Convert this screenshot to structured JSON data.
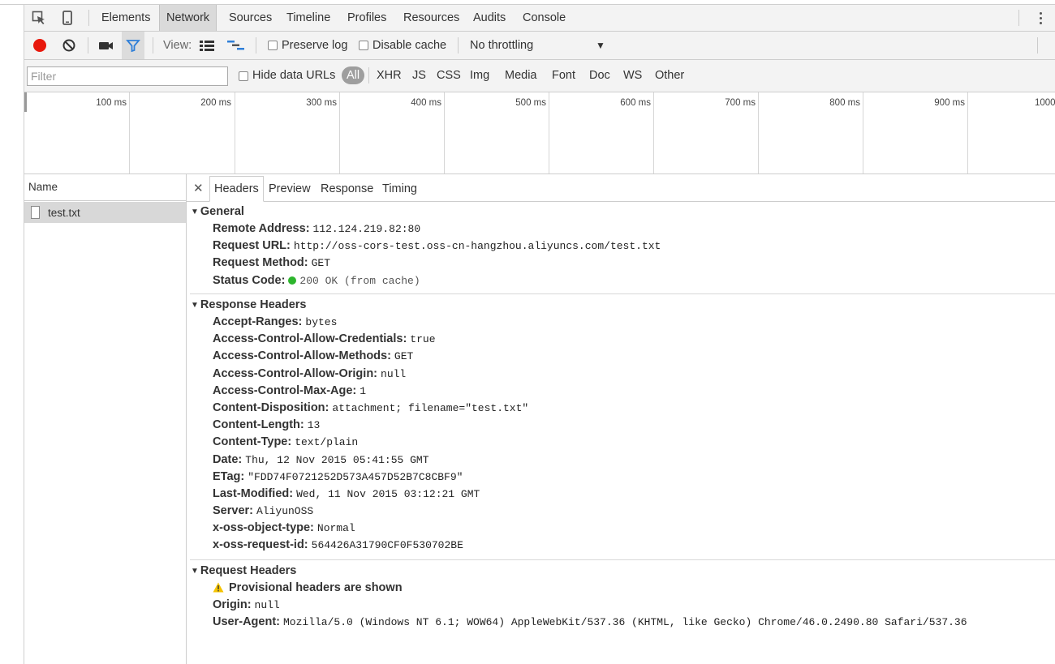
{
  "main_tabs": [
    "Elements",
    "Network",
    "Sources",
    "Timeline",
    "Profiles",
    "Resources",
    "Audits",
    "Console"
  ],
  "active_tab": "Network",
  "toolbar": {
    "view_label": "View:",
    "preserve_log": "Preserve log",
    "disable_cache": "Disable cache",
    "throttling": "No throttling"
  },
  "filter": {
    "placeholder": "Filter",
    "hide_data_urls": "Hide data URLs",
    "types": [
      "All",
      "XHR",
      "JS",
      "CSS",
      "Img",
      "Media",
      "Font",
      "Doc",
      "WS",
      "Other"
    ]
  },
  "timeline": {
    "ticks": [
      "100 ms",
      "200 ms",
      "300 ms",
      "400 ms",
      "500 ms",
      "600 ms",
      "700 ms",
      "800 ms",
      "900 ms",
      "1000"
    ]
  },
  "name_panel": {
    "header": "Name",
    "requests": [
      "test.txt"
    ]
  },
  "detail_tabs": [
    "Headers",
    "Preview",
    "Response",
    "Timing"
  ],
  "general": {
    "title": "General",
    "rows": [
      {
        "key": "Remote Address:",
        "value": "112.124.219.82:80"
      },
      {
        "key": "Request URL:",
        "value": "http://oss-cors-test.oss-cn-hangzhou.aliyuncs.com/test.txt"
      },
      {
        "key": "Request Method:",
        "value": "GET"
      }
    ],
    "status_key": "Status Code:",
    "status_value": "200 OK (from cache)",
    "status_color": "#2db52d"
  },
  "response_headers": {
    "title": "Response Headers",
    "rows": [
      {
        "key": "Accept-Ranges:",
        "value": "bytes"
      },
      {
        "key": "Access-Control-Allow-Credentials:",
        "value": "true"
      },
      {
        "key": "Access-Control-Allow-Methods:",
        "value": "GET"
      },
      {
        "key": "Access-Control-Allow-Origin:",
        "value": "null"
      },
      {
        "key": "Access-Control-Max-Age:",
        "value": "1"
      },
      {
        "key": "Content-Disposition:",
        "value": "attachment; filename=\"test.txt\""
      },
      {
        "key": "Content-Length:",
        "value": "13"
      },
      {
        "key": "Content-Type:",
        "value": "text/plain"
      },
      {
        "key": "Date:",
        "value": "Thu, 12 Nov 2015 05:41:55 GMT"
      },
      {
        "key": "ETag:",
        "value": "\"FDD74F0721252D573A457D52B7C8CBF9\""
      },
      {
        "key": "Last-Modified:",
        "value": "Wed, 11 Nov 2015 03:12:21 GMT"
      },
      {
        "key": "Server:",
        "value": "AliyunOSS"
      },
      {
        "key": "x-oss-object-type:",
        "value": "Normal"
      },
      {
        "key": "x-oss-request-id:",
        "value": "564426A31790CF0F530702BE"
      }
    ]
  },
  "request_headers": {
    "title": "Request Headers",
    "warning": "Provisional headers are shown",
    "rows": [
      {
        "key": "Origin:",
        "value": "null"
      },
      {
        "key": "User-Agent:",
        "value": "Mozilla/5.0 (Windows NT 6.1; WOW64) AppleWebKit/537.36 (KHTML, like Gecko) Chrome/46.0.2490.80 Safari/537.36"
      }
    ]
  },
  "colors": {
    "record": "#e8180c",
    "filter_active": "#2f7fd8",
    "warning": "#f4c300"
  }
}
